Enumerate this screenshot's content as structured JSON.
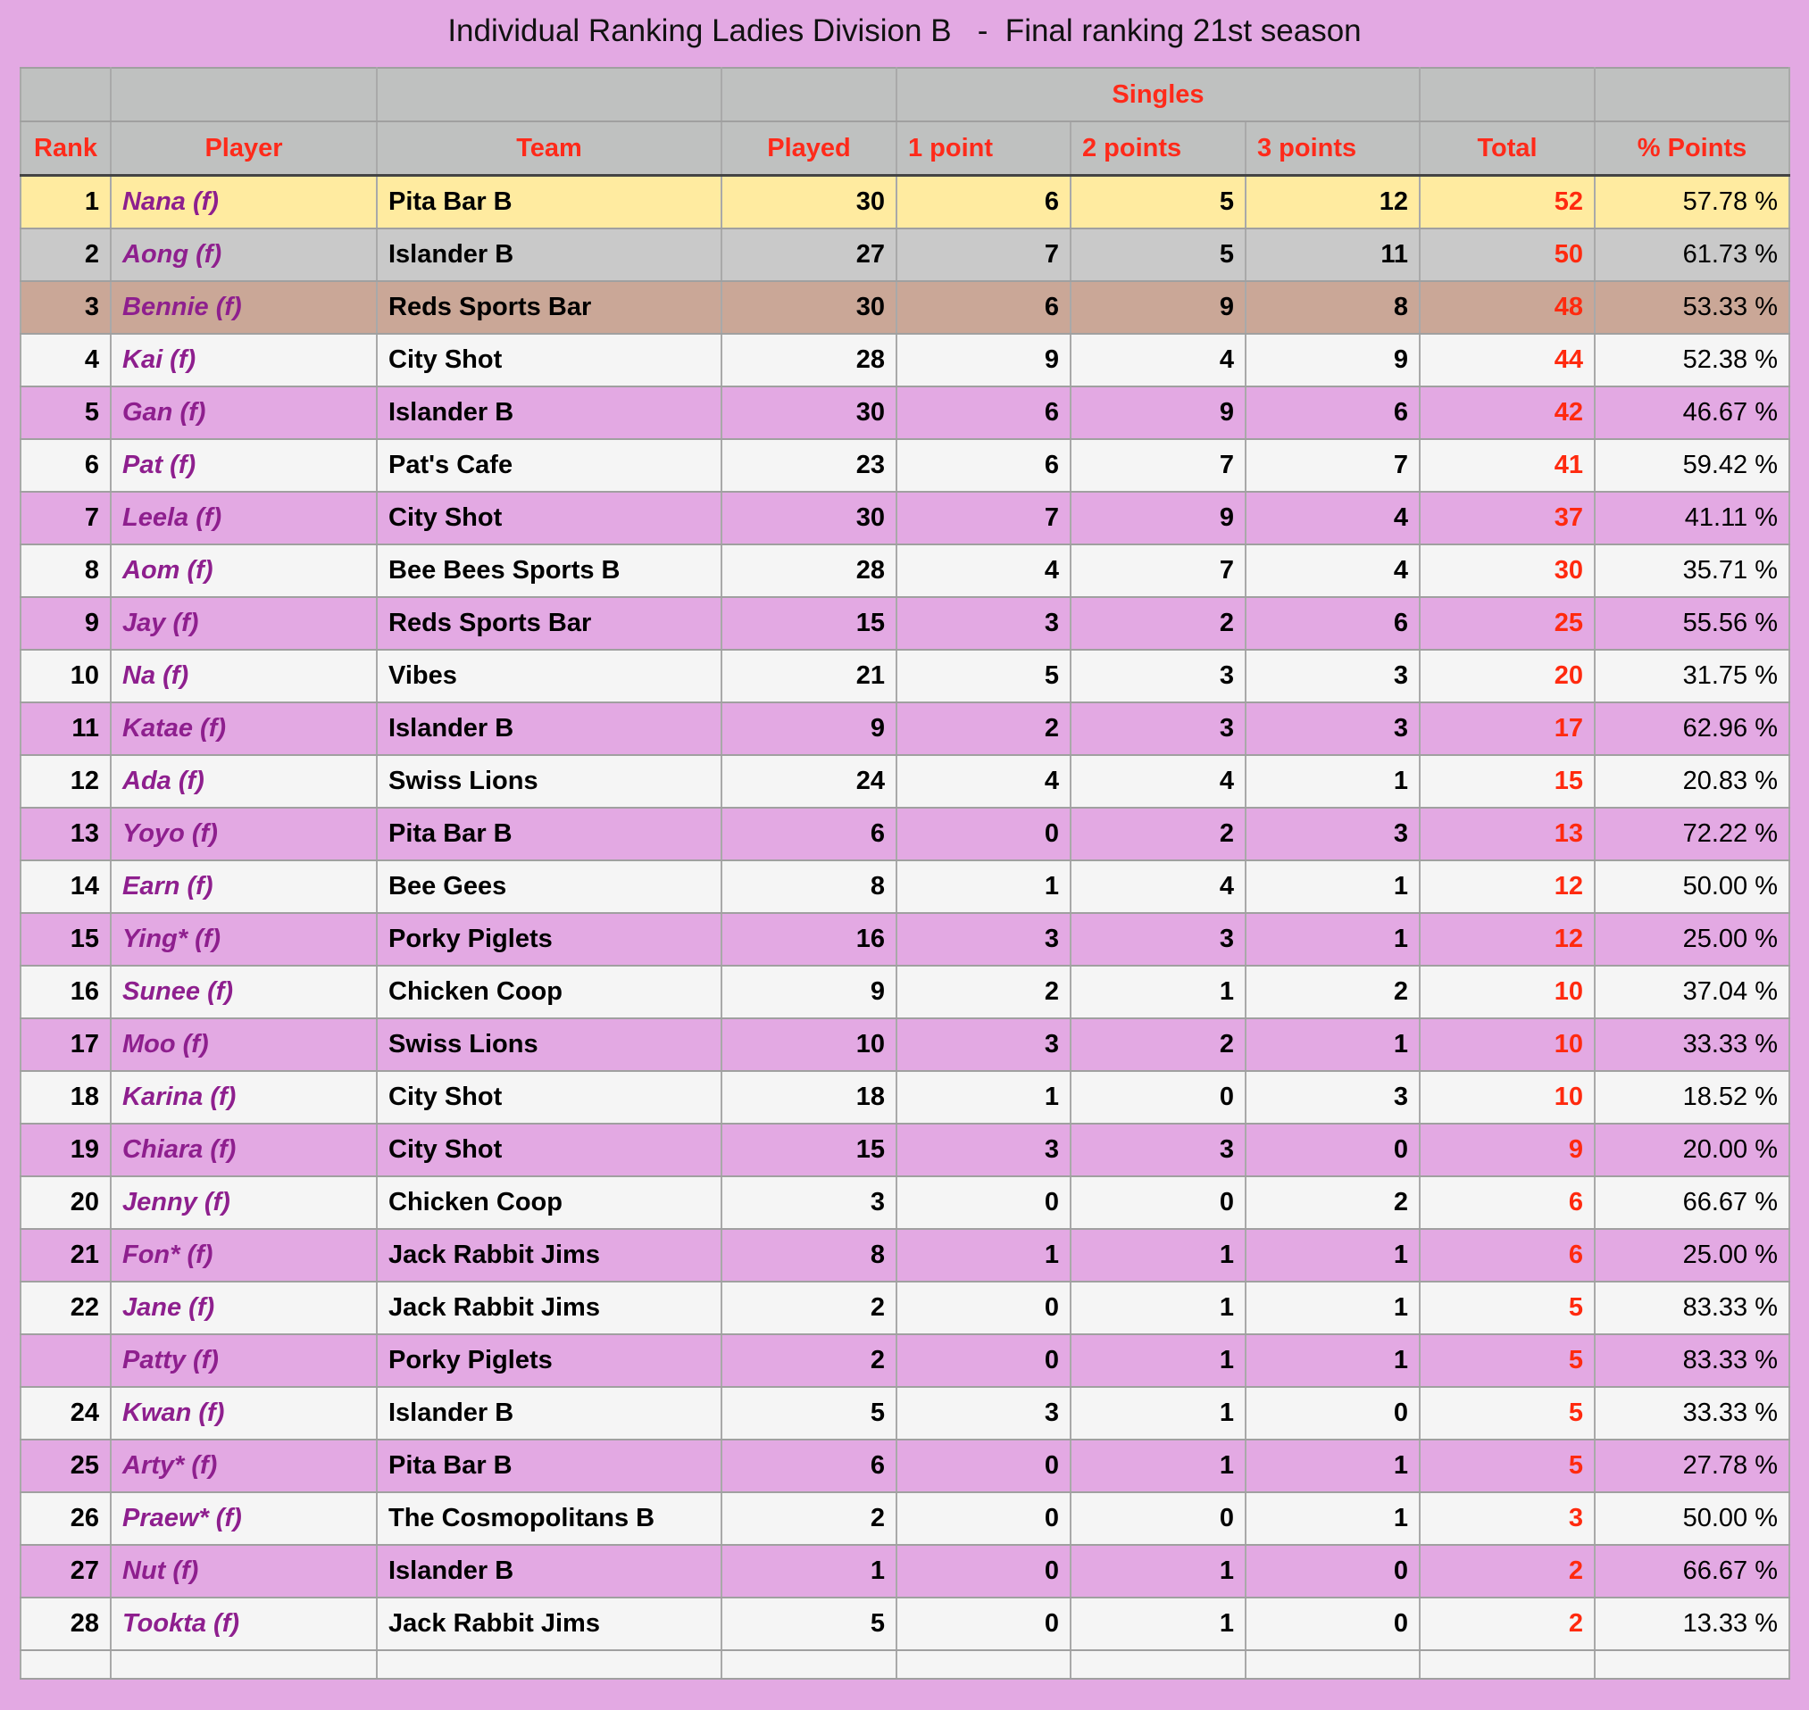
{
  "title": "Individual Ranking Ladies Division B   -  Final ranking 21st season",
  "header": {
    "group_label": "Singles",
    "columns": {
      "rank": "Rank",
      "player": "Player",
      "team": "Team",
      "played": "Played",
      "one_point": "1 point",
      "two_points": "2 points",
      "three_points": "3 points",
      "total": "Total",
      "pct_points": "% Points"
    }
  },
  "colors": {
    "page_background": "#e3a9e3",
    "header_background": "#bfc1c0",
    "header_text": "#ff2a1a",
    "player_text": "#8e1f8e",
    "total_text": "#ff2a0f",
    "gold_row": "#ffeba0",
    "silver_row": "#c9c9c9",
    "bronze_row": "#caa797",
    "light_row": "#f5f5f5",
    "pink_row": "#e3a9e3"
  },
  "rows": [
    {
      "rank": "1",
      "player": "Nana (f)",
      "team": "Pita Bar B",
      "played": "30",
      "p1": "6",
      "p2": "5",
      "p3": "12",
      "total": "52",
      "pct": "57.78 %",
      "style": "gold"
    },
    {
      "rank": "2",
      "player": "Aong (f)",
      "team": "Islander B",
      "played": "27",
      "p1": "7",
      "p2": "5",
      "p3": "11",
      "total": "50",
      "pct": "61.73 %",
      "style": "silver"
    },
    {
      "rank": "3",
      "player": "Bennie (f)",
      "team": "Reds Sports Bar",
      "played": "30",
      "p1": "6",
      "p2": "9",
      "p3": "8",
      "total": "48",
      "pct": "53.33 %",
      "style": "bronze"
    },
    {
      "rank": "4",
      "player": "Kai (f)",
      "team": "City Shot",
      "played": "28",
      "p1": "9",
      "p2": "4",
      "p3": "9",
      "total": "44",
      "pct": "52.38 %",
      "style": "light"
    },
    {
      "rank": "5",
      "player": "Gan (f)",
      "team": "Islander B",
      "played": "30",
      "p1": "6",
      "p2": "9",
      "p3": "6",
      "total": "42",
      "pct": "46.67 %",
      "style": "pink"
    },
    {
      "rank": "6",
      "player": "Pat (f)",
      "team": "Pat's Cafe",
      "played": "23",
      "p1": "6",
      "p2": "7",
      "p3": "7",
      "total": "41",
      "pct": "59.42 %",
      "style": "light"
    },
    {
      "rank": "7",
      "player": "Leela (f)",
      "team": "City Shot",
      "played": "30",
      "p1": "7",
      "p2": "9",
      "p3": "4",
      "total": "37",
      "pct": "41.11 %",
      "style": "pink"
    },
    {
      "rank": "8",
      "player": "Aom (f)",
      "team": "Bee Bees Sports B",
      "played": "28",
      "p1": "4",
      "p2": "7",
      "p3": "4",
      "total": "30",
      "pct": "35.71 %",
      "style": "light"
    },
    {
      "rank": "9",
      "player": "Jay (f)",
      "team": "Reds Sports Bar",
      "played": "15",
      "p1": "3",
      "p2": "2",
      "p3": "6",
      "total": "25",
      "pct": "55.56 %",
      "style": "pink"
    },
    {
      "rank": "10",
      "player": "Na (f)",
      "team": "Vibes",
      "played": "21",
      "p1": "5",
      "p2": "3",
      "p3": "3",
      "total": "20",
      "pct": "31.75 %",
      "style": "light"
    },
    {
      "rank": "11",
      "player": "Katae (f)",
      "team": "Islander B",
      "played": "9",
      "p1": "2",
      "p2": "3",
      "p3": "3",
      "total": "17",
      "pct": "62.96 %",
      "style": "pink"
    },
    {
      "rank": "12",
      "player": "Ada (f)",
      "team": "Swiss Lions",
      "played": "24",
      "p1": "4",
      "p2": "4",
      "p3": "1",
      "total": "15",
      "pct": "20.83 %",
      "style": "light"
    },
    {
      "rank": "13",
      "player": "Yoyo (f)",
      "team": "Pita Bar B",
      "played": "6",
      "p1": "0",
      "p2": "2",
      "p3": "3",
      "total": "13",
      "pct": "72.22 %",
      "style": "pink"
    },
    {
      "rank": "14",
      "player": "Earn (f)",
      "team": "Bee Gees",
      "played": "8",
      "p1": "1",
      "p2": "4",
      "p3": "1",
      "total": "12",
      "pct": "50.00 %",
      "style": "light"
    },
    {
      "rank": "15",
      "player": "Ying* (f)",
      "team": "Porky Piglets",
      "played": "16",
      "p1": "3",
      "p2": "3",
      "p3": "1",
      "total": "12",
      "pct": "25.00 %",
      "style": "pink"
    },
    {
      "rank": "16",
      "player": "Sunee (f)",
      "team": "Chicken Coop",
      "played": "9",
      "p1": "2",
      "p2": "1",
      "p3": "2",
      "total": "10",
      "pct": "37.04 %",
      "style": "light"
    },
    {
      "rank": "17",
      "player": "Moo (f)",
      "team": "Swiss Lions",
      "played": "10",
      "p1": "3",
      "p2": "2",
      "p3": "1",
      "total": "10",
      "pct": "33.33 %",
      "style": "pink"
    },
    {
      "rank": "18",
      "player": "Karina (f)",
      "team": "City Shot",
      "played": "18",
      "p1": "1",
      "p2": "0",
      "p3": "3",
      "total": "10",
      "pct": "18.52 %",
      "style": "light"
    },
    {
      "rank": "19",
      "player": "Chiara (f)",
      "team": "City Shot",
      "played": "15",
      "p1": "3",
      "p2": "3",
      "p3": "0",
      "total": "9",
      "pct": "20.00 %",
      "style": "pink"
    },
    {
      "rank": "20",
      "player": "Jenny (f)",
      "team": "Chicken Coop",
      "played": "3",
      "p1": "0",
      "p2": "0",
      "p3": "2",
      "total": "6",
      "pct": "66.67 %",
      "style": "light"
    },
    {
      "rank": "21",
      "player": "Fon* (f)",
      "team": "Jack Rabbit Jims",
      "played": "8",
      "p1": "1",
      "p2": "1",
      "p3": "1",
      "total": "6",
      "pct": "25.00 %",
      "style": "pink"
    },
    {
      "rank": "22",
      "player": "Jane (f)",
      "team": "Jack Rabbit Jims",
      "played": "2",
      "p1": "0",
      "p2": "1",
      "p3": "1",
      "total": "5",
      "pct": "83.33 %",
      "style": "light"
    },
    {
      "rank": "",
      "player": "Patty (f)",
      "team": "Porky Piglets",
      "played": "2",
      "p1": "0",
      "p2": "1",
      "p3": "1",
      "total": "5",
      "pct": "83.33 %",
      "style": "pink"
    },
    {
      "rank": "24",
      "player": "Kwan (f)",
      "team": "Islander B",
      "played": "5",
      "p1": "3",
      "p2": "1",
      "p3": "0",
      "total": "5",
      "pct": "33.33 %",
      "style": "light"
    },
    {
      "rank": "25",
      "player": "Arty* (f)",
      "team": "Pita Bar B",
      "played": "6",
      "p1": "0",
      "p2": "1",
      "p3": "1",
      "total": "5",
      "pct": "27.78 %",
      "style": "pink"
    },
    {
      "rank": "26",
      "player": "Praew* (f)",
      "team": "The Cosmopolitans B",
      "played": "2",
      "p1": "0",
      "p2": "0",
      "p3": "1",
      "total": "3",
      "pct": "50.00 %",
      "style": "light"
    },
    {
      "rank": "27",
      "player": "Nut (f)",
      "team": "Islander B",
      "played": "1",
      "p1": "0",
      "p2": "1",
      "p3": "0",
      "total": "2",
      "pct": "66.67 %",
      "style": "pink"
    },
    {
      "rank": "28",
      "player": "Tookta (f)",
      "team": "Jack Rabbit Jims",
      "played": "5",
      "p1": "0",
      "p2": "1",
      "p3": "0",
      "total": "2",
      "pct": "13.33 %",
      "style": "light"
    }
  ]
}
